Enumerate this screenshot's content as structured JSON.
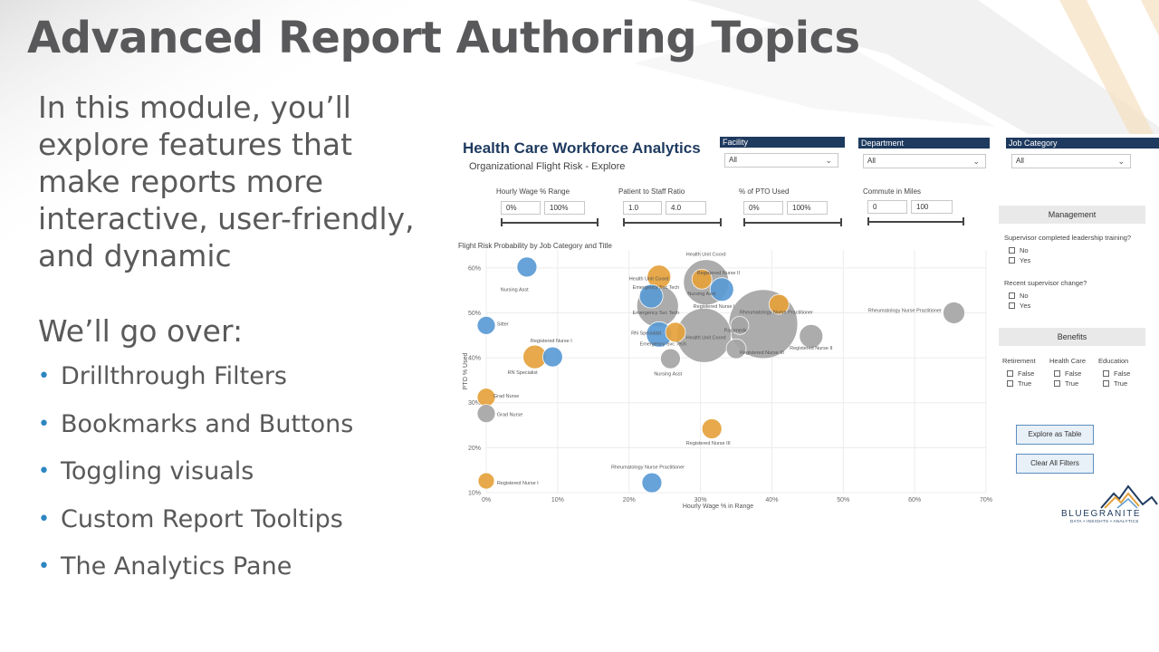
{
  "slide": {
    "title": "Advanced Report Authoring Topics",
    "intro": "In this module, you’ll explore features that make reports more interactive, user-friendly, and dynamic",
    "goover": "We’ll go over:",
    "bullets": [
      "Drillthrough Filters",
      "Bookmarks and Buttons",
      "Toggling visuals",
      "Custom Report Tooltips",
      "The Analytics Pane"
    ],
    "colors": {
      "accent": "#2e86c1",
      "title": "#59595b",
      "navy": "#1e3a5f"
    }
  },
  "report": {
    "title": "Health Care Workforce Analytics",
    "subtitle": "Organizational Flight Risk - Explore",
    "slicers": {
      "facility": {
        "label": "Facility",
        "value": "All"
      },
      "department": {
        "label": "Department",
        "value": "All"
      },
      "job_category": {
        "label": "Job Category",
        "value": "All"
      }
    },
    "ranges": {
      "hourly_wage": {
        "label": "Hourly Wage % Range",
        "min": "0%",
        "max": "100%"
      },
      "patient_staff": {
        "label": "Patient to Staff Ratio",
        "min": "1.0",
        "max": "4.0"
      },
      "pto_used": {
        "label": "% of PTO Used",
        "min": "0%",
        "max": "100%"
      },
      "commute": {
        "label": "Commute in Miles",
        "min": "0",
        "max": "100"
      }
    },
    "management": {
      "header": "Management",
      "q1": "Supervisor completed leadership training?",
      "q1_options": [
        "No",
        "Yes"
      ],
      "q2": "Recent supervisor change?",
      "q2_options": [
        "No",
        "Yes"
      ]
    },
    "benefits": {
      "header": "Benefits",
      "columns": [
        {
          "label": "Retirement",
          "options": [
            "False",
            "True"
          ]
        },
        {
          "label": "Health Care",
          "options": [
            "False",
            "True"
          ]
        },
        {
          "label": "Education",
          "options": [
            "False",
            "True"
          ]
        }
      ]
    },
    "buttons": {
      "explore": "Explore as Table",
      "clear": "Clear All Filters"
    },
    "brand": {
      "name": "BLUEGRANITE",
      "tagline": "DATA • INSIGHTS • ANALYTICS"
    }
  },
  "chart_data": {
    "type": "scatter",
    "title": "Flight Risk Probability by Job Category and Title",
    "xlabel": "Hourly Wage % in Range",
    "ylabel": "PTO % Used",
    "xlim": [
      0,
      70
    ],
    "ylim": [
      10,
      64
    ],
    "x_ticks": [
      "0%",
      "10%",
      "20%",
      "30%",
      "40%",
      "50%",
      "60%",
      "70%"
    ],
    "y_ticks": [
      "10%",
      "20%",
      "30%",
      "40%",
      "50%",
      "60%"
    ],
    "grid": true,
    "colors": {
      "blue": "#5b9bd5",
      "orange": "#e6a23c",
      "gray": "#a6a6a6"
    },
    "points": [
      {
        "x": 5.7,
        "y": 60.2,
        "r": 11,
        "color": "blue",
        "label": "Nursing Asst",
        "lx": 2,
        "ly": 54.8
      },
      {
        "x": 0,
        "y": 47.2,
        "r": 10,
        "color": "blue",
        "label": "Sitter",
        "lx": 1.5,
        "ly": 47.2
      },
      {
        "x": 6.8,
        "y": 40.2,
        "r": 13,
        "color": "orange",
        "label": "RN Specialist",
        "lx": 3,
        "ly": 36.4
      },
      {
        "x": 9.3,
        "y": 40.2,
        "r": 11,
        "color": "blue",
        "label": "Registered Nurse I",
        "lx": 6.2,
        "ly": 43.4
      },
      {
        "x": 0,
        "y": 31.2,
        "r": 10,
        "color": "orange",
        "label": "Grad Nurse",
        "lx": 1,
        "ly": 31.2
      },
      {
        "x": 0,
        "y": 27.6,
        "r": 10,
        "color": "gray",
        "label": "Grad Nurse",
        "lx": 1.5,
        "ly": 27
      },
      {
        "x": 0,
        "y": 12.6,
        "r": 9,
        "color": "orange",
        "label": "Registered Nurse I",
        "lx": 1.5,
        "ly": 11.8
      },
      {
        "x": 23.2,
        "y": 12.2,
        "r": 11,
        "color": "blue",
        "label": "Rheumatology Nurse Practitioner",
        "lx": 17.5,
        "ly": 15.3
      },
      {
        "x": 31.6,
        "y": 24.2,
        "r": 11,
        "color": "orange",
        "label": "Registered Nurse III",
        "lx": 28,
        "ly": 20.7
      },
      {
        "x": 38.8,
        "y": 47.5,
        "r": 38,
        "color": "gray",
        "label": "Registered Nurse III",
        "lx": 35.5,
        "ly": 40.8
      },
      {
        "x": 30.8,
        "y": 56.8,
        "r": 25,
        "color": "gray",
        "label": "Health Unit Coord",
        "lx": 28,
        "ly": 62.7
      },
      {
        "x": 24,
        "y": 51.5,
        "r": 23,
        "color": "gray",
        "label": "Emergency Svc Tech",
        "lx": 20.5,
        "ly": 49.7
      },
      {
        "x": 30.5,
        "y": 45,
        "r": 30,
        "color": "gray",
        "label": "Health Unit Coord",
        "lx": 28,
        "ly": 44.2
      },
      {
        "x": 35.5,
        "y": 47.2,
        "r": 10,
        "color": "gray",
        "label": "Paramedic",
        "lx": 33.3,
        "ly": 45.8
      },
      {
        "x": 45.5,
        "y": 44.8,
        "r": 13,
        "color": "gray",
        "label": "Registered Nurse II",
        "lx": 42.5,
        "ly": 41.8
      },
      {
        "x": 65.5,
        "y": 50,
        "r": 12,
        "color": "gray",
        "label": "Rheumatology Nurse Practitioner",
        "lx": 53.5,
        "ly": 50.2
      },
      {
        "x": 41,
        "y": 51.9,
        "r": 11,
        "color": "orange",
        "label": "Rheumatology Nurse Practitioner",
        "lx": 35.5,
        "ly": 49.8
      },
      {
        "x": 24.2,
        "y": 58,
        "r": 13,
        "color": "orange",
        "label": "Health Unit Coord",
        "lx": 20,
        "ly": 57.3
      },
      {
        "x": 30.2,
        "y": 57.5,
        "r": 11,
        "color": "orange",
        "label": "Registered Nurse II",
        "lx": 29.5,
        "ly": 58.6
      },
      {
        "x": 33,
        "y": 55.2,
        "r": 13,
        "color": "blue",
        "label": "Nursing Asst",
        "lx": 28.2,
        "ly": 53.9
      },
      {
        "x": 23.1,
        "y": 53.7,
        "r": 13,
        "color": "blue",
        "label": "Emergency Svc Tech",
        "lx": 20.5,
        "ly": 55.3
      },
      {
        "x": 26.5,
        "y": 45.7,
        "r": 11,
        "color": "orange",
        "label": "Registered Nurse I",
        "lx": 29,
        "ly": 51.1
      },
      {
        "x": 24.2,
        "y": 45.2,
        "r": 14,
        "color": "blue",
        "label": "RN Specialist",
        "lx": 20.3,
        "ly": 45.2
      },
      {
        "x": 25.8,
        "y": 39.8,
        "r": 11,
        "color": "gray",
        "label": "Nursing Asst",
        "lx": 23.5,
        "ly": 36.1
      },
      {
        "x": 35,
        "y": 42,
        "r": 11,
        "color": "gray",
        "label": "Emergency Svc Tech",
        "lx": 21.5,
        "ly": 42.7
      }
    ]
  }
}
